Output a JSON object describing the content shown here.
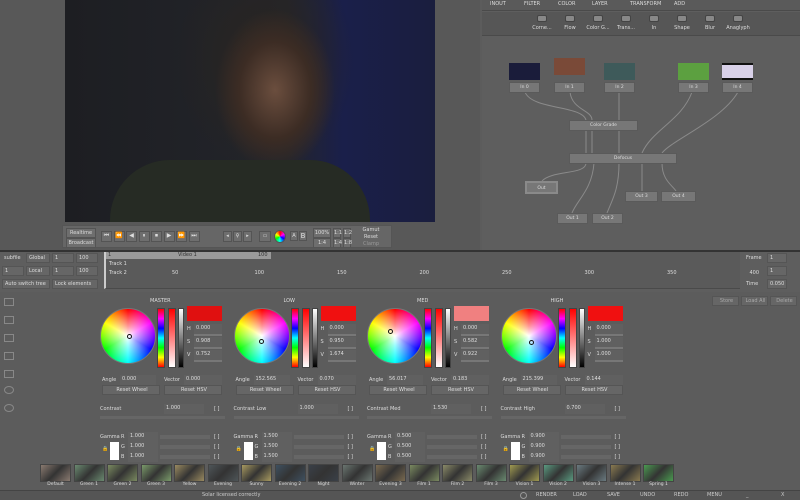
{
  "node_tabs": [
    "INOUT",
    "FILTER",
    "COLOR",
    "LAYER",
    "TRANSFORM",
    "ADD"
  ],
  "tools": [
    "Corne...",
    "Flow",
    "Color G...",
    "Trans...",
    "In",
    "Shape",
    "Blur",
    "Anaglyph"
  ],
  "inputs": [
    {
      "label": "In 0",
      "color": "#1a1c3a"
    },
    {
      "label": "In 1",
      "color": "#7a4a38"
    },
    {
      "label": "In 2",
      "color": "#3e5a5a"
    },
    {
      "label": "In 3",
      "color": "#5ca040"
    },
    {
      "label": "In 4",
      "color": "#d8d0e8"
    }
  ],
  "nodes": {
    "color_grade": "Color Grade",
    "defocus": "Defocus",
    "out": "Out",
    "out1": "Out 1",
    "out2": "Out 2",
    "out3": "Out 3",
    "out4": "Out 4"
  },
  "transport": {
    "realtime": "Realtime",
    "broadcast": "Broadcast",
    "zoom": "100%",
    "z11": "1:1",
    "z12": "1:2",
    "fit": "1:4",
    "z14": "1:4",
    "z18": "1:8",
    "ab_a": "A",
    "ab_b": "B",
    "gamut": "Gamut",
    "reset": "Reset",
    "clamp": "Clamp"
  },
  "timeline": {
    "subfile": "subfile",
    "global": "Global",
    "global_in": "1",
    "global_out": "100",
    "sel": "1",
    "local": "Local",
    "local_in": "1",
    "local_out": "100",
    "auto_switch": "Auto switch tree",
    "lock": "Lock elements",
    "clip_start": "1",
    "clip_name": "Video 1",
    "clip_end": "100",
    "track1": "Track 1",
    "track2": "Track 2",
    "ticks": [
      "50",
      "100",
      "150",
      "200",
      "250",
      "300",
      "350",
      "400"
    ],
    "frame_label": "Frame",
    "frame": "1",
    "frame2": "1",
    "time_label": "Time",
    "time": "0.050"
  },
  "panels": [
    {
      "title": "MASTER",
      "h": "0.000",
      "s": "0.908",
      "v": "0.752",
      "angle": "0.000",
      "vector": "0.000",
      "contrast_label": "Contrast",
      "contrast": "1.000",
      "gamma": [
        "1.000",
        "1.000",
        "1.000"
      ],
      "swatch": "#e01010"
    },
    {
      "title": "LOW",
      "h": "0.000",
      "s": "0.950",
      "v": "1.674",
      "angle": "152.565",
      "vector": "0.070",
      "contrast_label": "Contrast Low",
      "contrast": "1.000",
      "gamma": [
        "1.500",
        "1.500",
        "1.500"
      ],
      "swatch": "#f01010"
    },
    {
      "title": "MED",
      "h": "0.000",
      "s": "0.582",
      "v": "0.922",
      "angle": "56.017",
      "vector": "0.183",
      "contrast_label": "Contrast Med",
      "contrast": "1.530",
      "gamma": [
        "0.500",
        "0.500",
        "0.500"
      ],
      "swatch": "#f08080"
    },
    {
      "title": "HIGH",
      "h": "0.000",
      "s": "1.000",
      "v": "1.000",
      "angle": "215.399",
      "vector": "0.144",
      "contrast_label": "Contrast High",
      "contrast": "0.700",
      "gamma": [
        "0.900",
        "0.900",
        "0.900"
      ],
      "swatch": "#f01010"
    }
  ],
  "labels": {
    "h": "H",
    "s": "S",
    "v": "V",
    "angle": "Angle",
    "vector": "Vector",
    "reset_wheel": "Reset Wheel",
    "reset_hsv": "Reset HSV",
    "gamma": "Gamma",
    "r": "R",
    "g": "G",
    "b": "B",
    "bracket": "[ ]"
  },
  "preset_buttons": [
    "Store",
    "Load All",
    "Delete"
  ],
  "presets": [
    {
      "n": "Default",
      "c": "#8a7a70"
    },
    {
      "n": "Green 1",
      "c": "#6a8a70"
    },
    {
      "n": "Green 2",
      "c": "#7a8a60"
    },
    {
      "n": "Green 3",
      "c": "#7a9a6a"
    },
    {
      "n": "Yellow",
      "c": "#9a8a60"
    },
    {
      "n": "Evening",
      "c": "#4e5558"
    },
    {
      "n": "Sunny",
      "c": "#a89a60"
    },
    {
      "n": "Evening 2",
      "c": "#3e5060"
    },
    {
      "n": "Night",
      "c": "#3a4048"
    },
    {
      "n": "Winter",
      "c": "#6a7570"
    },
    {
      "n": "Evening 3",
      "c": "#7a6a50"
    },
    {
      "n": "Film 1",
      "c": "#7a8a60"
    },
    {
      "n": "Film 2",
      "c": "#8a8a68"
    },
    {
      "n": "Film 3",
      "c": "#6a8a70"
    },
    {
      "n": "Vision 1",
      "c": "#a09a50"
    },
    {
      "n": "Vision 2",
      "c": "#5a9a80"
    },
    {
      "n": "Vision 3",
      "c": "#6a7a80"
    },
    {
      "n": "Intense 1",
      "c": "#8a7a50"
    },
    {
      "n": "Spring 1",
      "c": "#4a9a50"
    }
  ],
  "status": {
    "message": "Solar licensed correctly",
    "render": "RENDER",
    "load": "LOAD",
    "save": "SAVE",
    "undo": "UNDO",
    "redo": "REDO",
    "menu": "MENU",
    "minimize": "_",
    "close": "X"
  }
}
